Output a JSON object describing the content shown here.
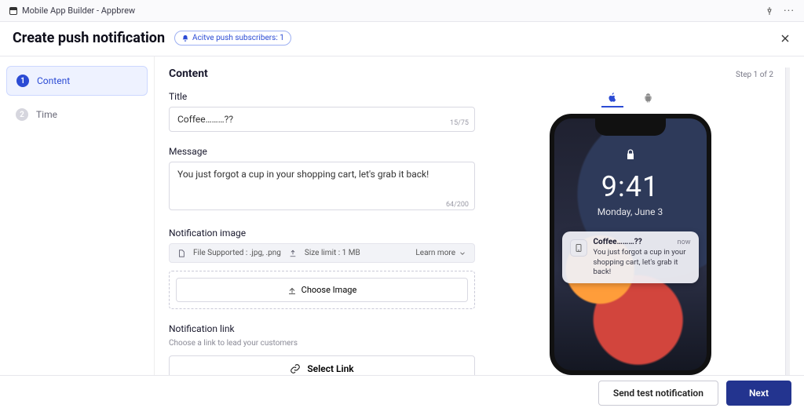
{
  "topbar": {
    "app_name": "Mobile App Builder - Appbrew"
  },
  "header": {
    "title": "Create push notification",
    "subscribers_label": "Acitve push subscribers: 1"
  },
  "sidebar": {
    "steps": [
      {
        "num": "1",
        "label": "Content"
      },
      {
        "num": "2",
        "label": "Time"
      }
    ]
  },
  "content": {
    "section_title": "Content",
    "step_counter": "Step 1 of 2",
    "title_label": "Title",
    "title_value": "Coffee………??",
    "title_counter": "15/75",
    "message_label": "Message",
    "message_value": "You just forgot a cup in your shopping cart, let's grab it back!",
    "message_counter": "64/200",
    "image_label": "Notification image",
    "file_supported_label": "File Supported :",
    "file_supported_value": ".jpg, .png",
    "size_limit_label": "Size limit :",
    "size_limit_value": "1 MB",
    "learn_more": "Learn more",
    "choose_image": "Choose Image",
    "link_label": "Notification link",
    "link_hint": "Choose a link to lead your customers",
    "select_link": "Select Link"
  },
  "preview": {
    "time": "9:41",
    "date": "Monday, June 3",
    "notif_title": "Coffee………??",
    "notif_ago": "now",
    "notif_msg": "You just forgot a cup in your shopping cart, let's grab it back!"
  },
  "footer": {
    "test_label": "Send test notification",
    "next_label": "Next"
  }
}
